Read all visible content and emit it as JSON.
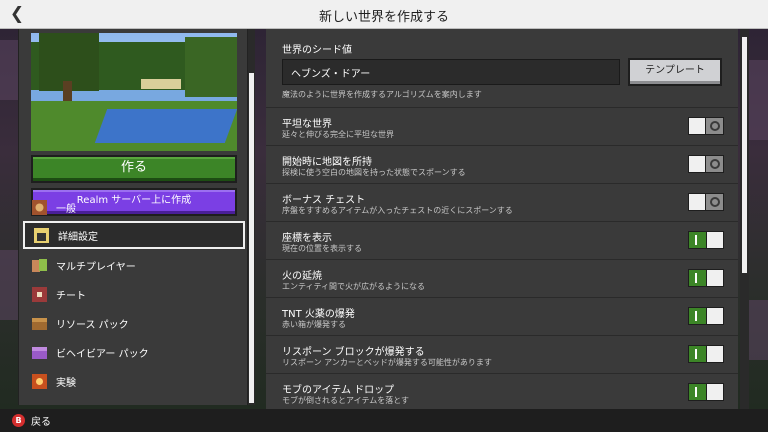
{
  "header": {
    "title": "新しい世界を作成する",
    "back_icon": "chevron-left-icon"
  },
  "left": {
    "create_label": "作る",
    "realm_label": "Realm サーバー上に作成",
    "nav_items": [
      {
        "label": "一般",
        "icon": "general-icon",
        "selected": false
      },
      {
        "label": "詳細設定",
        "icon": "advanced-settings-icon",
        "selected": true
      },
      {
        "label": "マルチプレイヤー",
        "icon": "multiplayer-icon",
        "selected": false
      },
      {
        "label": "チート",
        "icon": "cheats-icon",
        "selected": false
      },
      {
        "label": "リソース パック",
        "icon": "resource-pack-icon",
        "selected": false
      },
      {
        "label": "ビヘイビアー パック",
        "icon": "behavior-pack-icon",
        "selected": false
      },
      {
        "label": "実験",
        "icon": "experiments-icon",
        "selected": false
      }
    ]
  },
  "seed": {
    "label": "世界のシード値",
    "value": "ヘブンズ・ドアー",
    "template_label": "テンプレート",
    "description": "魔法のように世界を作成するアルゴリズムを案内します"
  },
  "settings": [
    {
      "title": "平坦な世界",
      "desc": "延々と伸びる完全に平坦な世界",
      "on": false
    },
    {
      "title": "開始時に地図を所持",
      "desc": "探検に使う空白の地図を持った状態でスポーンする",
      "on": false
    },
    {
      "title": "ボーナス チェスト",
      "desc": "序盤をすすめるアイテムが入ったチェストの近くにスポーンする",
      "on": false
    },
    {
      "title": "座標を表示",
      "desc": "現在の位置を表示する",
      "on": true
    },
    {
      "title": "火の延焼",
      "desc": "エンティティ間で火が広がるようになる",
      "on": true
    },
    {
      "title": "TNT 火薬の爆発",
      "desc": "赤い箱が爆発する",
      "on": true
    },
    {
      "title": "リスポーン ブロックが爆発する",
      "desc": "リスポーン アンカーとベッドが爆発する可能性があります",
      "on": true
    },
    {
      "title": "モブのアイテム ドロップ",
      "desc": "モブが倒されるとアイテムを落とす",
      "on": true
    }
  ],
  "footer": {
    "button_key": "B",
    "back_label": "戻る"
  },
  "colors": {
    "green": "#3c8527",
    "purple": "#7b3fe4",
    "panel": "#3a3a3a"
  }
}
